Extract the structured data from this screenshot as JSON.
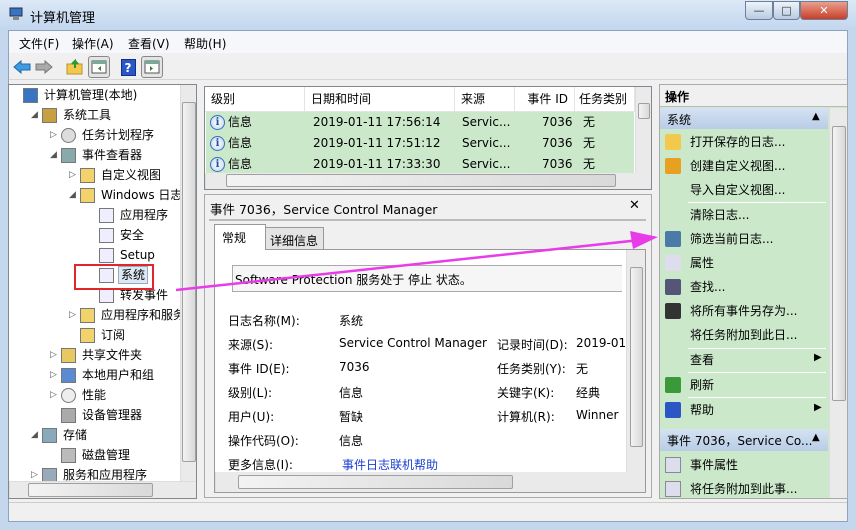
{
  "window": {
    "title": "计算机管理",
    "min": "—",
    "max": "□",
    "close": "✕"
  },
  "menu": [
    "文件(F)",
    "操作(A)",
    "查看(V)",
    "帮助(H)"
  ],
  "toolbar": {
    "help": "?"
  },
  "tree": [
    {
      "label": "计算机管理(本地)",
      "level": 0,
      "exp": "none",
      "icon": "computer-icon"
    },
    {
      "label": "系统工具",
      "level": 1,
      "exp": "open",
      "icon": "tools-icon"
    },
    {
      "label": "任务计划程序",
      "level": 2,
      "exp": "closed",
      "icon": "clock-icon"
    },
    {
      "label": "事件查看器",
      "level": 2,
      "exp": "open",
      "icon": "event-viewer-icon"
    },
    {
      "label": "自定义视图",
      "level": 3,
      "exp": "closed",
      "icon": "folder-filter-icon"
    },
    {
      "label": "Windows 日志",
      "level": 3,
      "exp": "open",
      "icon": "folder-icon"
    },
    {
      "label": "应用程序",
      "level": 4,
      "exp": "none",
      "icon": "log-icon"
    },
    {
      "label": "安全",
      "level": 4,
      "exp": "none",
      "icon": "log-icon"
    },
    {
      "label": "Setup",
      "level": 4,
      "exp": "none",
      "icon": "log-icon"
    },
    {
      "label": "系统",
      "level": 4,
      "exp": "none",
      "icon": "log-icon",
      "selected": true
    },
    {
      "label": "转发事件",
      "level": 4,
      "exp": "none",
      "icon": "log-icon"
    },
    {
      "label": "应用程序和服务日",
      "level": 3,
      "exp": "closed",
      "icon": "folder-icon"
    },
    {
      "label": "订阅",
      "level": 3,
      "exp": "none",
      "icon": "subscription-icon"
    },
    {
      "label": "共享文件夹",
      "level": 2,
      "exp": "closed",
      "icon": "shared-folder-icon"
    },
    {
      "label": "本地用户和组",
      "level": 2,
      "exp": "closed",
      "icon": "users-icon"
    },
    {
      "label": "性能",
      "level": 2,
      "exp": "closed",
      "icon": "performance-icon"
    },
    {
      "label": "设备管理器",
      "level": 2,
      "exp": "none",
      "icon": "device-manager-icon"
    },
    {
      "label": "存储",
      "level": 1,
      "exp": "open",
      "icon": "storage-icon"
    },
    {
      "label": "磁盘管理",
      "level": 2,
      "exp": "none",
      "icon": "disk-icon"
    },
    {
      "label": "服务和应用程序",
      "level": 1,
      "exp": "closed",
      "icon": "services-icon"
    }
  ],
  "events": {
    "columns": [
      "级别",
      "日期和时间",
      "来源",
      "事件 ID",
      "任务类别"
    ],
    "rows": [
      {
        "level": "信息",
        "datetime": "2019-01-11 17:56:14",
        "source": "Servic...",
        "id": "7036",
        "category": "无"
      },
      {
        "level": "信息",
        "datetime": "2019-01-11 17:51:12",
        "source": "Servic...",
        "id": "7036",
        "category": "无"
      },
      {
        "level": "信息",
        "datetime": "2019-01-11 17:33:30",
        "source": "Servic...",
        "id": "7036",
        "category": "无"
      }
    ]
  },
  "detail": {
    "title": "事件 7036，Service Control Manager",
    "close": "✕",
    "tabs": [
      "常规",
      "详细信息"
    ],
    "message": "Software Protection 服务处于 停止 状态。",
    "fields": {
      "log_name_label": "日志名称(M):",
      "log_name": "系统",
      "source_label": "来源(S):",
      "source": "Service Control Manager",
      "logged_label": "记录时间(D):",
      "logged": "2019-01",
      "event_id_label": "事件 ID(E):",
      "event_id": "7036",
      "task_label": "任务类别(Y):",
      "task": "无",
      "level_label": "级别(L):",
      "level": "信息",
      "keywords_label": "关键字(K):",
      "keywords": "经典",
      "user_label": "用户(U):",
      "user": "暂缺",
      "computer_label": "计算机(R):",
      "computer": "Winner",
      "opcode_label": "操作代码(O):",
      "opcode": "信息",
      "more_label": "更多信息(I):",
      "more_link": "事件日志联机帮助"
    }
  },
  "actions": {
    "title": "操作",
    "section1": "系统",
    "items1": [
      "打开保存的日志...",
      "创建自定义视图...",
      "导入自定义视图...",
      "清除日志...",
      "筛选当前日志...",
      "属性",
      "查找...",
      "将所有事件另存为...",
      "将任务附加到此日...",
      "查看",
      "刷新",
      "帮助"
    ],
    "section2": "事件 7036，Service Co...",
    "items2": [
      "事件属性",
      "将任务附加到此事..."
    ]
  },
  "colors": {
    "selection_green": "#cbe8cb",
    "section_blue": "#c3d5ea",
    "annotation": "#e83ce8",
    "highlight_box": "#e0262c"
  }
}
